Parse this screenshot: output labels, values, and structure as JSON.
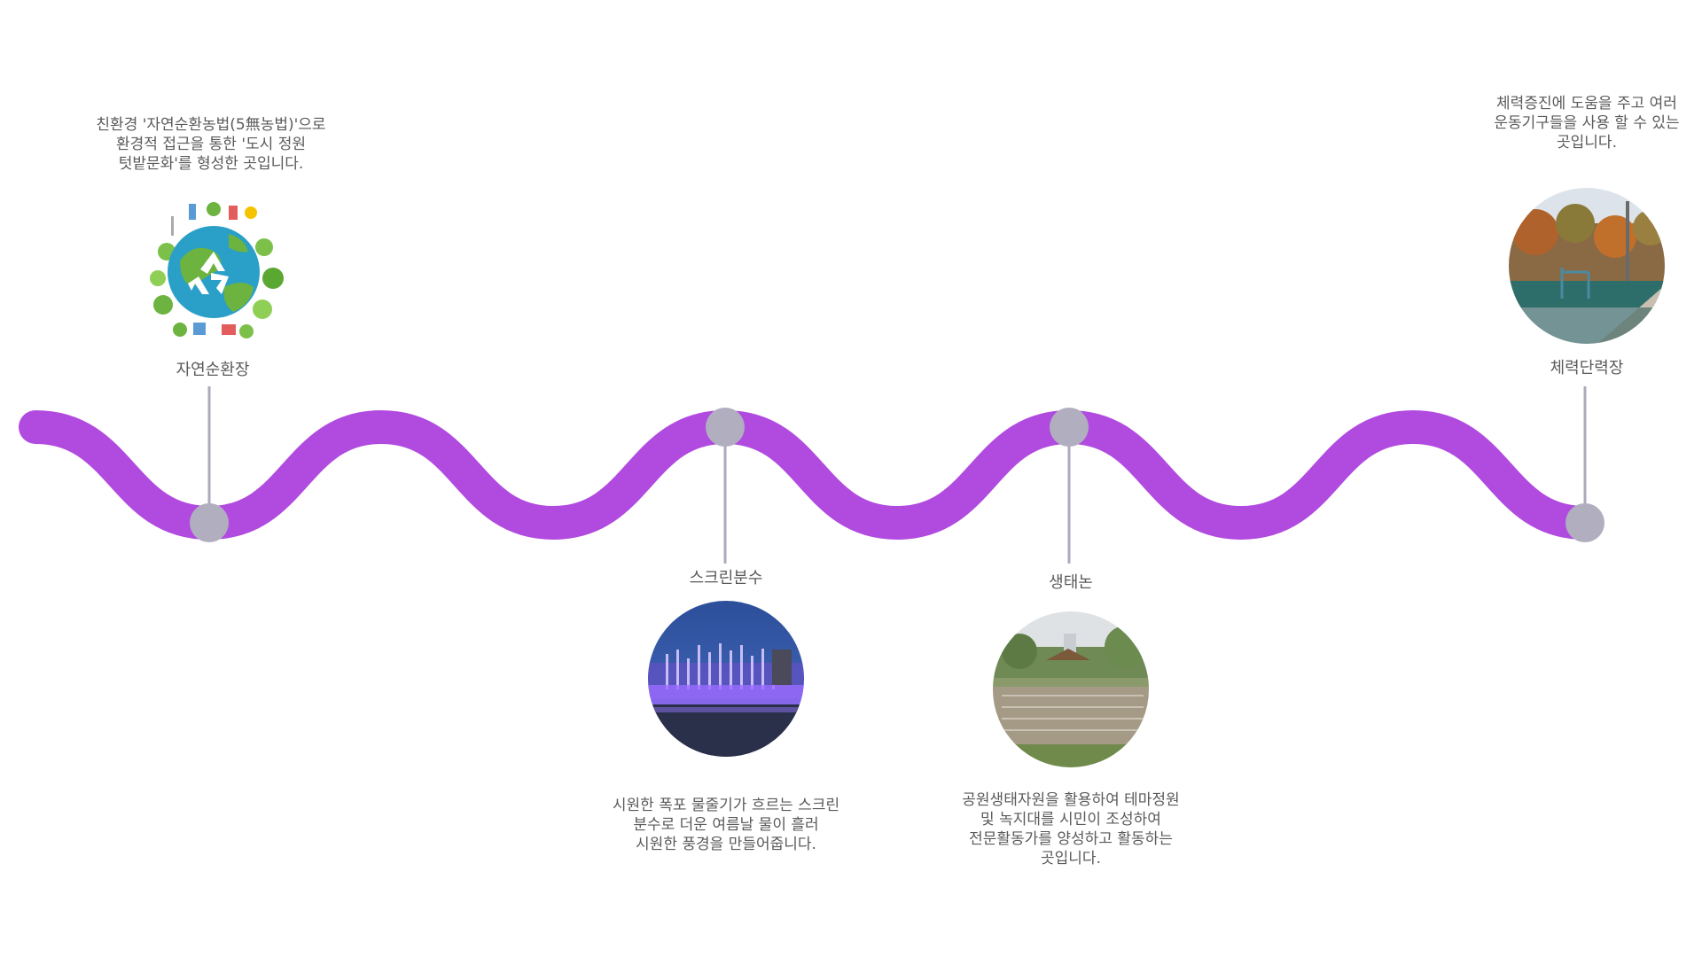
{
  "colors": {
    "wave": "#b14adf",
    "node": "#b1aec0",
    "connector": "#aeaabc",
    "text": "#5a5a5a"
  },
  "stations": [
    {
      "id": "nature-cycle",
      "label": "자연순환장",
      "description": "친환경 '자연순환농법(5無농법)'으로\n환경적 접근을 통한 '도시 정원\n텃밭문화'를 형성한 곳입니다.",
      "icon": "eco-earth-recycle-icon"
    },
    {
      "id": "screen-fountain",
      "label": "스크린분수",
      "description": "시원한 폭포 물줄기가 흐르는 스크린\n분수로 더운 여름날 물이 흘러\n시원한 풍경을 만들어줍니다.",
      "icon": "fountain-photo"
    },
    {
      "id": "eco-paddy",
      "label": "생태논",
      "description": "공원생태자원을 활용하여 테마정원\n및 녹지대를 시민이 조성하여\n전문활동가를 양성하고 활동하는\n곳입니다.",
      "icon": "paddy-field-photo"
    },
    {
      "id": "fitness",
      "label": "체력단력장",
      "description": "체력증진에 도움을 주고 여러\n운동기구들을 사용 할 수 있는\n곳입니다.",
      "icon": "fitness-park-photo"
    }
  ]
}
